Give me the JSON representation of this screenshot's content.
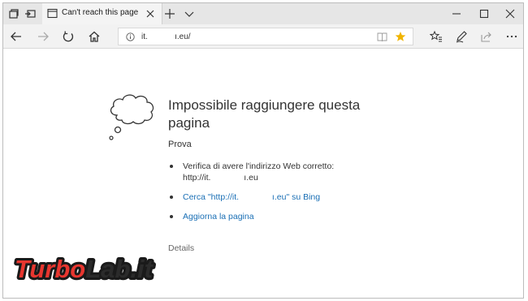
{
  "tab": {
    "title": "Can't reach this page"
  },
  "address": {
    "url": "it.            ı.eu/"
  },
  "error": {
    "title": "Impossibile raggiungere questa pagina",
    "try_label": "Prova",
    "suggestions": [
      {
        "text": "Verifica di avere l'indirizzo Web corretto:\nhttp://it.              ı.eu",
        "link": false
      },
      {
        "text": "Cerca \"http://it.              ı.eu\" su Bing",
        "link": true
      },
      {
        "text": "Aggiorna la pagina",
        "link": true
      }
    ],
    "details_label": "Details"
  },
  "watermark": {
    "text": "TurboLab.it"
  },
  "colors": {
    "link": "#1a6fb5",
    "star": "#f0b400",
    "watermark_red": "#e8362f"
  },
  "icons": [
    "tab-manager-icon",
    "set-aside-tabs-icon",
    "page-icon",
    "close-icon",
    "plus-icon",
    "chevron-down-icon",
    "minimize-icon",
    "maximize-icon",
    "close-window-icon",
    "back-icon",
    "forward-icon",
    "refresh-icon",
    "home-icon",
    "info-icon",
    "reading-view-icon",
    "favorite-star-icon",
    "favorites-hub-icon",
    "pen-icon",
    "share-icon",
    "more-icon",
    "thought-cloud-icon"
  ]
}
